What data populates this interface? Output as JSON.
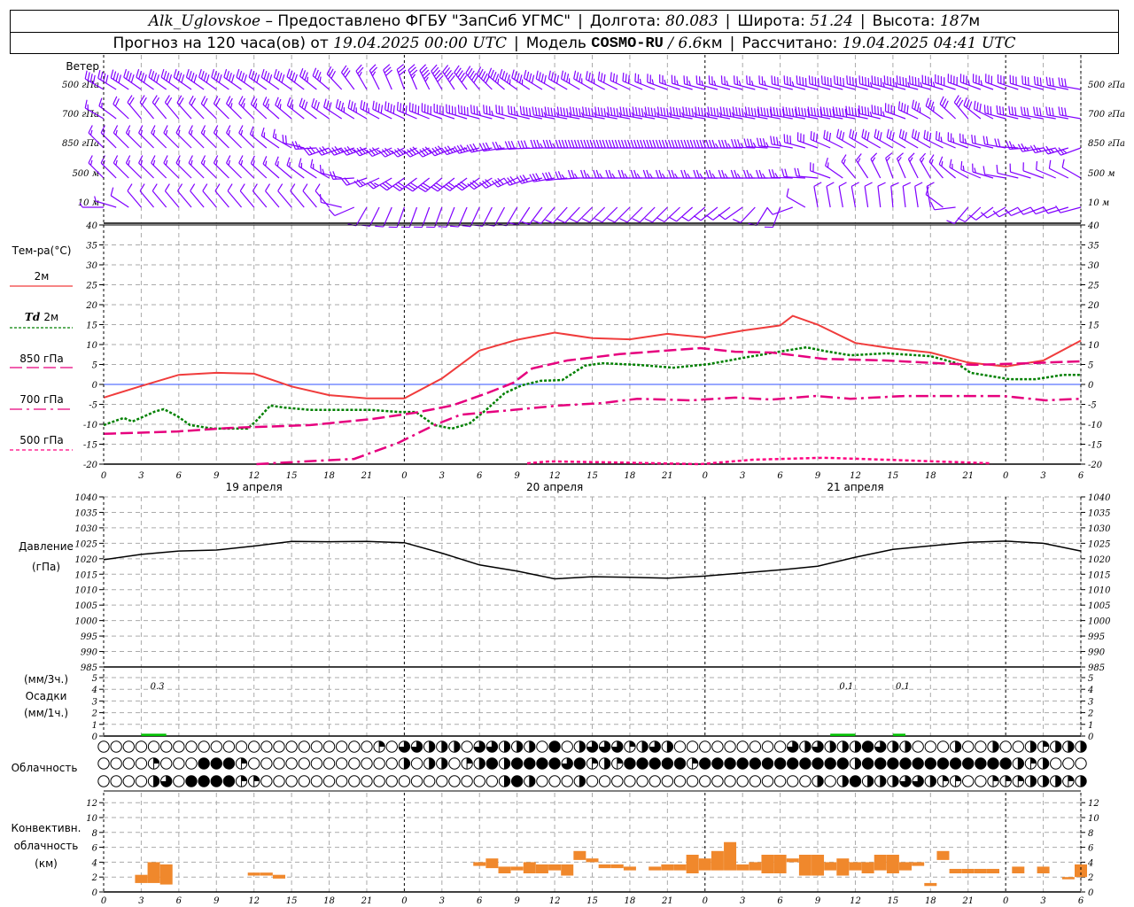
{
  "header": {
    "station": "Alk_Uglovskoe",
    "provider": " – Предоставлено ФГБУ \"ЗапСиб УГМС\"",
    "lon_label": "Долгота: ",
    "lon": "80.083",
    "lat_label": "Широта: ",
    "lat": "51.24",
    "alt_label": "Высота: ",
    "alt": "187",
    "alt_unit": "м",
    "forecast_label": "Прогноз на 120 часа(ов) от ",
    "forecast_start": "19.04.2025 00:00 UTC",
    "model_label": "Модель ",
    "model": "COSMO-RU",
    "model_sep": " / ",
    "resolution": "6.6",
    "resolution_unit": "км",
    "computed_label": "Рассчитано: ",
    "computed": "19.04.2025 04:41 UTC"
  },
  "hour_labels": [
    "0",
    "3",
    "6",
    "9",
    "12",
    "15",
    "18",
    "21",
    "0",
    "3",
    "6",
    "9",
    "12",
    "15",
    "18",
    "21",
    "0",
    "3",
    "6",
    "9",
    "12",
    "15",
    "18",
    "21",
    "0",
    "3",
    "6"
  ],
  "date_labels": [
    "19 апреля",
    "20 апреля",
    "21 апреля"
  ],
  "colors": {
    "t2m": "#f03c3c",
    "td2m": "#008000",
    "p850": "#e6007e",
    "p700": "#e6007e",
    "p500": "#ff0080",
    "zero": "#3050ff",
    "wind": "#8000ff",
    "precip": "#00c000",
    "conv": "#f0882c",
    "pressure": "#000000"
  },
  "chart_data": [
    {
      "type": "wind-barbs",
      "title": "Ветер",
      "levels": [
        "500 гПа",
        "700 гПа",
        "850 гПа",
        "500 м",
        "10 м"
      ],
      "hours": [
        0,
        3,
        6,
        9,
        12,
        15,
        18,
        21,
        24,
        27,
        30,
        33,
        36,
        39,
        42,
        45,
        48,
        51,
        54,
        57,
        60,
        63,
        66,
        69,
        72,
        75,
        78
      ],
      "direction_deg": [
        [
          300,
          305,
          305,
          305,
          305,
          305,
          310,
          330,
          340,
          330,
          320,
          305,
          300,
          300,
          295,
          290,
          285,
          285,
          285,
          285,
          285,
          285,
          285,
          290,
          290,
          285,
          280
        ],
        [
          300,
          320,
          320,
          315,
          315,
          310,
          305,
          300,
          295,
          290,
          285,
          285,
          280,
          280,
          280,
          280,
          280,
          280,
          280,
          280,
          280,
          285,
          300,
          320,
          285,
          280,
          280
        ],
        [
          315,
          315,
          315,
          315,
          315,
          300,
          250,
          250,
          245,
          245,
          255,
          265,
          270,
          270,
          270,
          270,
          270,
          270,
          275,
          290,
          300,
          300,
          300,
          290,
          280,
          260,
          250
        ],
        [
          315,
          315,
          315,
          315,
          315,
          310,
          300,
          250,
          235,
          230,
          235,
          245,
          260,
          270,
          270,
          270,
          270,
          270,
          270,
          275,
          320,
          340,
          330,
          300,
          280,
          290,
          300
        ],
        [
          270,
          320,
          320,
          320,
          320,
          320,
          320,
          210,
          200,
          200,
          205,
          210,
          220,
          225,
          225,
          225,
          230,
          235,
          200,
          350,
          350,
          355,
          350,
          220,
          240,
          250,
          255
        ]
      ],
      "speed_ms": [
        [
          20,
          20,
          20,
          20,
          20,
          20,
          18,
          12,
          15,
          25,
          25,
          22,
          20,
          18,
          15,
          12,
          12,
          12,
          12,
          20,
          20,
          22,
          22,
          20,
          15,
          15,
          15
        ],
        [
          8,
          10,
          10,
          10,
          12,
          12,
          15,
          18,
          20,
          20,
          20,
          15,
          22,
          22,
          22,
          22,
          22,
          22,
          25,
          25,
          25,
          22,
          18,
          15,
          15,
          15,
          15
        ],
        [
          8,
          8,
          8,
          8,
          8,
          8,
          15,
          18,
          18,
          20,
          18,
          12,
          18,
          20,
          20,
          20,
          20,
          18,
          18,
          15,
          15,
          15,
          15,
          12,
          10,
          12,
          12
        ],
        [
          8,
          8,
          8,
          8,
          8,
          8,
          8,
          10,
          15,
          15,
          15,
          15,
          15,
          12,
          12,
          12,
          12,
          12,
          12,
          10,
          8,
          8,
          8,
          8,
          6,
          6,
          6
        ],
        [
          3,
          5,
          5,
          5,
          5,
          5,
          5,
          5,
          6,
          6,
          6,
          6,
          6,
          5,
          5,
          5,
          5,
          5,
          5,
          6,
          6,
          6,
          5,
          5,
          5,
          5,
          5
        ]
      ]
    },
    {
      "type": "line",
      "ylabel": "Тем-ра(°C)",
      "ylim": [
        -20,
        40
      ],
      "yticks": [
        40,
        35,
        30,
        25,
        20,
        15,
        10,
        5,
        0,
        -5,
        -10,
        -15,
        -20
      ],
      "series": [
        {
          "name": "2м",
          "key": "t2m",
          "style": "solid",
          "x": [
            0,
            3,
            6,
            9,
            12,
            15,
            18,
            21,
            24,
            27,
            30,
            33,
            36,
            39,
            42,
            45,
            48,
            51,
            54,
            55,
            57,
            60,
            63,
            66,
            69,
            72,
            75,
            78
          ],
          "y": [
            -3.3,
            -0.4,
            2.4,
            2.9,
            2.7,
            -0.5,
            -2.7,
            -3.5,
            -3.5,
            1.5,
            8.5,
            11.2,
            13.0,
            11.6,
            11.3,
            12.7,
            11.8,
            13.5,
            14.8,
            17.2,
            15.0,
            10.4,
            9.0,
            8.0,
            5.5,
            4.5,
            6.0,
            11.0
          ]
        },
        {
          "name": "Td 2м",
          "key": "td2m",
          "style": "dotted",
          "x": [
            0,
            1.6,
            2.3,
            4.1,
            4.8,
            5.9,
            6.9,
            8.7,
            11.5,
            12.2,
            13.3,
            14.4,
            16.5,
            21.4,
            23.5,
            24.9,
            26.4,
            27.8,
            29.2,
            30.6,
            32,
            33.4,
            34.9,
            36.6,
            38.4,
            39.8,
            42.6,
            45.5,
            48.3,
            51.1,
            53.9,
            56.1,
            57.5,
            59.6,
            62.5,
            66,
            68.1,
            69.2,
            72.3,
            74.4,
            76.6,
            78
          ],
          "y": [
            -10.2,
            -8.4,
            -9.3,
            -6.8,
            -6.2,
            -8,
            -10.2,
            -11.1,
            -11.1,
            -9.1,
            -5.3,
            -5.8,
            -6.4,
            -6.4,
            -6.9,
            -6.9,
            -10.2,
            -11.1,
            -9.8,
            -6.2,
            -2.2,
            -0.2,
            0.9,
            1.1,
            4.7,
            5.3,
            4.9,
            4.2,
            5.1,
            6.7,
            8.2,
            9.3,
            8.4,
            7.3,
            7.8,
            7.1,
            5.3,
            2.9,
            1.3,
            1.3,
            2.4,
            2.4
          ]
        },
        {
          "name": "850 гПа",
          "key": "p850",
          "style": "longdash",
          "x": [
            0,
            5.9,
            10.1,
            16.5,
            21.4,
            24.9,
            27.8,
            30.6,
            32.7,
            34.2,
            37,
            41.2,
            47.6,
            50.4,
            53.3,
            57.5,
            62.4,
            66.7,
            69.5,
            73.8,
            78
          ],
          "y": [
            -12.4,
            -11.8,
            -10.9,
            -10.2,
            -8.7,
            -7.1,
            -5.3,
            -2.2,
            0.4,
            4,
            6,
            7.6,
            9.1,
            8.2,
            8,
            6.4,
            6,
            5.3,
            4.9,
            5.3,
            5.8
          ]
        },
        {
          "name": "700 гПа",
          "key": "p700",
          "style": "dashdot",
          "x": [
            12.2,
            14.4,
            20,
            23.5,
            26.4,
            28.5,
            32.7,
            36.3,
            39.8,
            42.6,
            46.9,
            50.4,
            53.3,
            56.8,
            59.6,
            63.9,
            71.8,
            75.2,
            78
          ],
          "y": [
            -20,
            -19.6,
            -18.7,
            -14.7,
            -10.2,
            -7.6,
            -6.4,
            -5.3,
            -4.7,
            -3.6,
            -4,
            -3.3,
            -3.8,
            -2.9,
            -3.6,
            -2.9,
            -2.9,
            -4,
            -3.6
          ]
        },
        {
          "name": "500 гПа",
          "key": "p500",
          "style": "dashed",
          "x": [
            33.8,
            35.6,
            41.2,
            47.6,
            51.8,
            57.5,
            62.4,
            70.9
          ],
          "y": [
            -19.8,
            -19.3,
            -19.6,
            -20,
            -18.9,
            -18.4,
            -18.9,
            -19.8
          ]
        }
      ]
    },
    {
      "type": "line",
      "ylabel": "Давление",
      "yunit": "(гПа)",
      "ylim": [
        985,
        1040
      ],
      "yticks": [
        1040,
        1035,
        1030,
        1025,
        1020,
        1015,
        1010,
        1005,
        1000,
        995,
        990,
        985
      ],
      "series": [
        {
          "key": "pressure",
          "x": [
            0,
            3,
            6,
            9,
            12,
            15,
            18,
            21,
            24,
            27,
            30,
            33,
            36,
            39,
            42,
            45,
            48,
            51,
            54,
            57,
            60,
            63,
            66,
            69,
            72,
            75,
            78
          ],
          "y": [
            1019.7,
            1021.4,
            1022.5,
            1022.8,
            1024.1,
            1025.6,
            1025.5,
            1025.6,
            1025.2,
            1021.8,
            1018,
            1016,
            1013.5,
            1014.2,
            1014,
            1013.7,
            1014.4,
            1015.4,
            1016.4,
            1017.6,
            1020.5,
            1023,
            1024.2,
            1025.3,
            1025.7,
            1025,
            1022.5
          ]
        }
      ]
    },
    {
      "type": "bar",
      "ylabel_top": "(мм/3ч.)",
      "ylabel": "Осадки",
      "ylabel_bottom": "(мм/1ч.)",
      "ylim": [
        0,
        5
      ],
      "yticks": [
        5,
        4,
        3,
        2,
        1,
        0
      ],
      "bins": [
        {
          "start": 3,
          "end": 5,
          "total_3h": "0.3",
          "rate": 0.2
        },
        {
          "start": 58,
          "end": 60,
          "total_3h": "0.1",
          "rate": 0.2
        },
        {
          "start": 63,
          "end": 64,
          "total_3h": "0.1",
          "rate": 0.2
        }
      ]
    },
    {
      "type": "cloud-cover",
      "label": "Облачность",
      "scale": "quarters 0-4 per hour (rows top to bottom)",
      "rows": [
        "0000000000000000000000103322203322204023331232000000000323222432200020020021222232124121",
        "0000100044410000000000002022012424444341214444414444444444442444444444444212",
        "0000230444411000000000000000000024200020000000000000000002024222332110011122212122"
      ]
    },
    {
      "type": "range-bar",
      "ylabel": "Конвективн.",
      "ylabel2": "облачность",
      "yunit": "(км)",
      "ylim": [
        0,
        13
      ],
      "yticks": [
        12,
        10,
        8,
        6,
        4,
        2,
        0
      ],
      "bars": [
        [
          3,
          1.2,
          2.3
        ],
        [
          4,
          1.2,
          4.0
        ],
        [
          5,
          1.0,
          3.7
        ],
        [
          12,
          2.2,
          2.6
        ],
        [
          13,
          2.2,
          2.6
        ],
        [
          14,
          1.8,
          2.3
        ],
        [
          30,
          3.5,
          4.0
        ],
        [
          31,
          3.2,
          4.5
        ],
        [
          32,
          2.5,
          3.4
        ],
        [
          33,
          2.9,
          3.4
        ],
        [
          34,
          2.5,
          4.0
        ],
        [
          35,
          2.5,
          3.7
        ],
        [
          36,
          2.9,
          3.7
        ],
        [
          37,
          2.2,
          3.7
        ],
        [
          38,
          4.3,
          5.5
        ],
        [
          39,
          4.0,
          4.5
        ],
        [
          40,
          3.2,
          3.7
        ],
        [
          41,
          3.2,
          3.7
        ],
        [
          42,
          2.9,
          3.4
        ],
        [
          44,
          2.9,
          3.4
        ],
        [
          45,
          2.9,
          3.7
        ],
        [
          46,
          2.9,
          3.7
        ],
        [
          47,
          2.5,
          5.0
        ],
        [
          48,
          2.9,
          4.5
        ],
        [
          49,
          2.9,
          5.5
        ],
        [
          50,
          2.9,
          6.7
        ],
        [
          51,
          2.9,
          3.7
        ],
        [
          52,
          2.9,
          4.0
        ],
        [
          53,
          2.5,
          5.0
        ],
        [
          54,
          2.5,
          5.0
        ],
        [
          55,
          4.0,
          4.5
        ],
        [
          56,
          2.2,
          5.0
        ],
        [
          57,
          2.2,
          5.0
        ],
        [
          58,
          2.9,
          4.0
        ],
        [
          59,
          2.2,
          4.5
        ],
        [
          60,
          2.9,
          4.0
        ],
        [
          61,
          2.5,
          4.0
        ],
        [
          62,
          2.9,
          5.0
        ],
        [
          63,
          2.5,
          5.0
        ],
        [
          64,
          2.9,
          4.0
        ],
        [
          65,
          3.5,
          4.0
        ],
        [
          66,
          0.8,
          1.2
        ],
        [
          67,
          4.3,
          5.5
        ],
        [
          68,
          2.5,
          3.1
        ],
        [
          69,
          2.5,
          3.1
        ],
        [
          70,
          2.5,
          3.1
        ],
        [
          71,
          2.5,
          3.1
        ],
        [
          73,
          2.5,
          3.4
        ],
        [
          75,
          2.5,
          3.4
        ],
        [
          77,
          1.7,
          2.0
        ],
        [
          78,
          2.0,
          3.7
        ]
      ]
    }
  ]
}
